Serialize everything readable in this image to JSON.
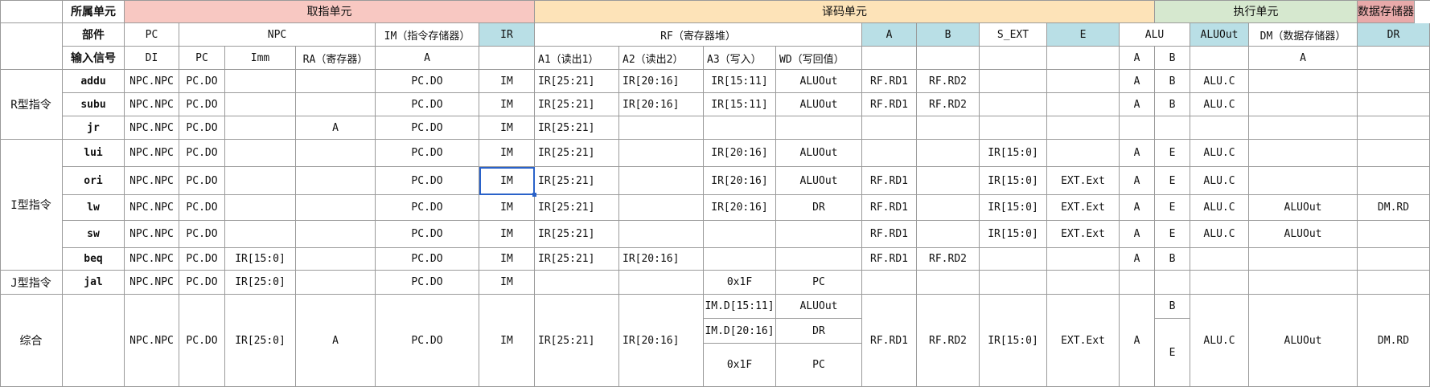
{
  "colors": {
    "fetch": "#f8c8c2",
    "decode": "#fde3b8",
    "execute": "#d6e8cf",
    "memory": "#e8a9a9",
    "blue": "#b9dfe6",
    "white": "#ffffff",
    "grid": "#9a9a9a",
    "selection": "#2a62c9"
  },
  "header": {
    "unit_label": "所属单元",
    "component_label": "部件",
    "signal_label": "输入信号",
    "units": [
      "取指单元",
      "译码单元",
      "执行单元",
      "数据存储器"
    ],
    "components": [
      "PC",
      "NPC",
      "IM（指令存储器）",
      "IR",
      "RF（寄存器堆）",
      "A",
      "B",
      "S_EXT",
      "E",
      "ALU",
      "ALUOut",
      "DM（数据存储器）",
      "DR"
    ],
    "signals": [
      "DI",
      "PC",
      "Imm",
      "RA（寄存器）",
      "A",
      "",
      "A1（读出1）",
      "A2（读出2）",
      "A3（写入）",
      "WD（写回值）",
      "",
      "",
      "",
      "",
      "A",
      "B",
      "",
      "A",
      ""
    ]
  },
  "groups": [
    "R型指令",
    "I型指令",
    "J型指令",
    "综合"
  ],
  "instructions": [
    {
      "name": "addu",
      "cells": [
        "NPC.NPC",
        "PC.DO",
        "",
        "",
        "PC.DO",
        "IM",
        "IR[25:21]",
        "IR[20:16]",
        "IR[15:11]",
        "ALUOut",
        "RF.RD1",
        "RF.RD2",
        "",
        "",
        "A",
        "B",
        "ALU.C",
        "",
        ""
      ]
    },
    {
      "name": "subu",
      "cells": [
        "NPC.NPC",
        "PC.DO",
        "",
        "",
        "PC.DO",
        "IM",
        "IR[25:21]",
        "IR[20:16]",
        "IR[15:11]",
        "ALUOut",
        "RF.RD1",
        "RF.RD2",
        "",
        "",
        "A",
        "B",
        "ALU.C",
        "",
        ""
      ]
    },
    {
      "name": "jr",
      "cells": [
        "NPC.NPC",
        "PC.DO",
        "",
        "A",
        "PC.DO",
        "IM",
        "IR[25:21]",
        "",
        "",
        "",
        "",
        "",
        "",
        "",
        "",
        "",
        "",
        "",
        ""
      ]
    },
    {
      "name": "lui",
      "cells": [
        "NPC.NPC",
        "PC.DO",
        "",
        "",
        "PC.DO",
        "IM",
        "IR[25:21]",
        "",
        "IR[20:16]",
        "ALUOut",
        "",
        "",
        "IR[15:0]",
        "",
        "A",
        "E",
        "ALU.C",
        "",
        ""
      ]
    },
    {
      "name": "ori",
      "cells": [
        "NPC.NPC",
        "PC.DO",
        "",
        "",
        "PC.DO",
        "IM",
        "IR[25:21]",
        "",
        "IR[20:16]",
        "ALUOut",
        "RF.RD1",
        "",
        "IR[15:0]",
        "EXT.Ext",
        "A",
        "E",
        "ALU.C",
        "",
        ""
      ]
    },
    {
      "name": "lw",
      "cells": [
        "NPC.NPC",
        "PC.DO",
        "",
        "",
        "PC.DO",
        "IM",
        "IR[25:21]",
        "",
        "IR[20:16]",
        "DR",
        "RF.RD1",
        "",
        "IR[15:0]",
        "EXT.Ext",
        "A",
        "E",
        "ALU.C",
        "ALUOut",
        "DM.RD"
      ]
    },
    {
      "name": "sw",
      "cells": [
        "NPC.NPC",
        "PC.DO",
        "",
        "",
        "PC.DO",
        "IM",
        "IR[25:21]",
        "",
        "",
        "",
        "RF.RD1",
        "",
        "IR[15:0]",
        "EXT.Ext",
        "A",
        "E",
        "ALU.C",
        "ALUOut",
        ""
      ]
    },
    {
      "name": "beq",
      "cells": [
        "NPC.NPC",
        "PC.DO",
        "IR[15:0]",
        "",
        "PC.DO",
        "IM",
        "IR[25:21]",
        "IR[20:16]",
        "",
        "",
        "RF.RD1",
        "RF.RD2",
        "",
        "",
        "A",
        "B",
        "",
        "",
        ""
      ]
    },
    {
      "name": "jal",
      "cells": [
        "NPC.NPC",
        "PC.DO",
        "IR[25:0]",
        "",
        "PC.DO",
        "IM",
        "",
        "",
        "0x1F",
        "PC",
        "",
        "",
        "",
        "",
        "",
        "",
        "",
        "",
        ""
      ]
    }
  ],
  "summary": {
    "cells": [
      "NPC.NPC",
      "PC.DO",
      "IR[25:0]",
      "A",
      "PC.DO",
      "IM",
      "IR[25:21]",
      "IR[20:16]",
      "",
      "",
      "RF.RD1",
      "RF.RD2",
      "IR[15:0]",
      "EXT.Ext",
      "A",
      "",
      "ALU.C",
      "ALUOut",
      "DM.RD"
    ],
    "a3": [
      "IM.D[15:11]",
      "IM.D[20:16]",
      "0x1F"
    ],
    "wd": [
      "ALUOut",
      "DR",
      "PC"
    ],
    "b": [
      "B",
      "E"
    ]
  }
}
